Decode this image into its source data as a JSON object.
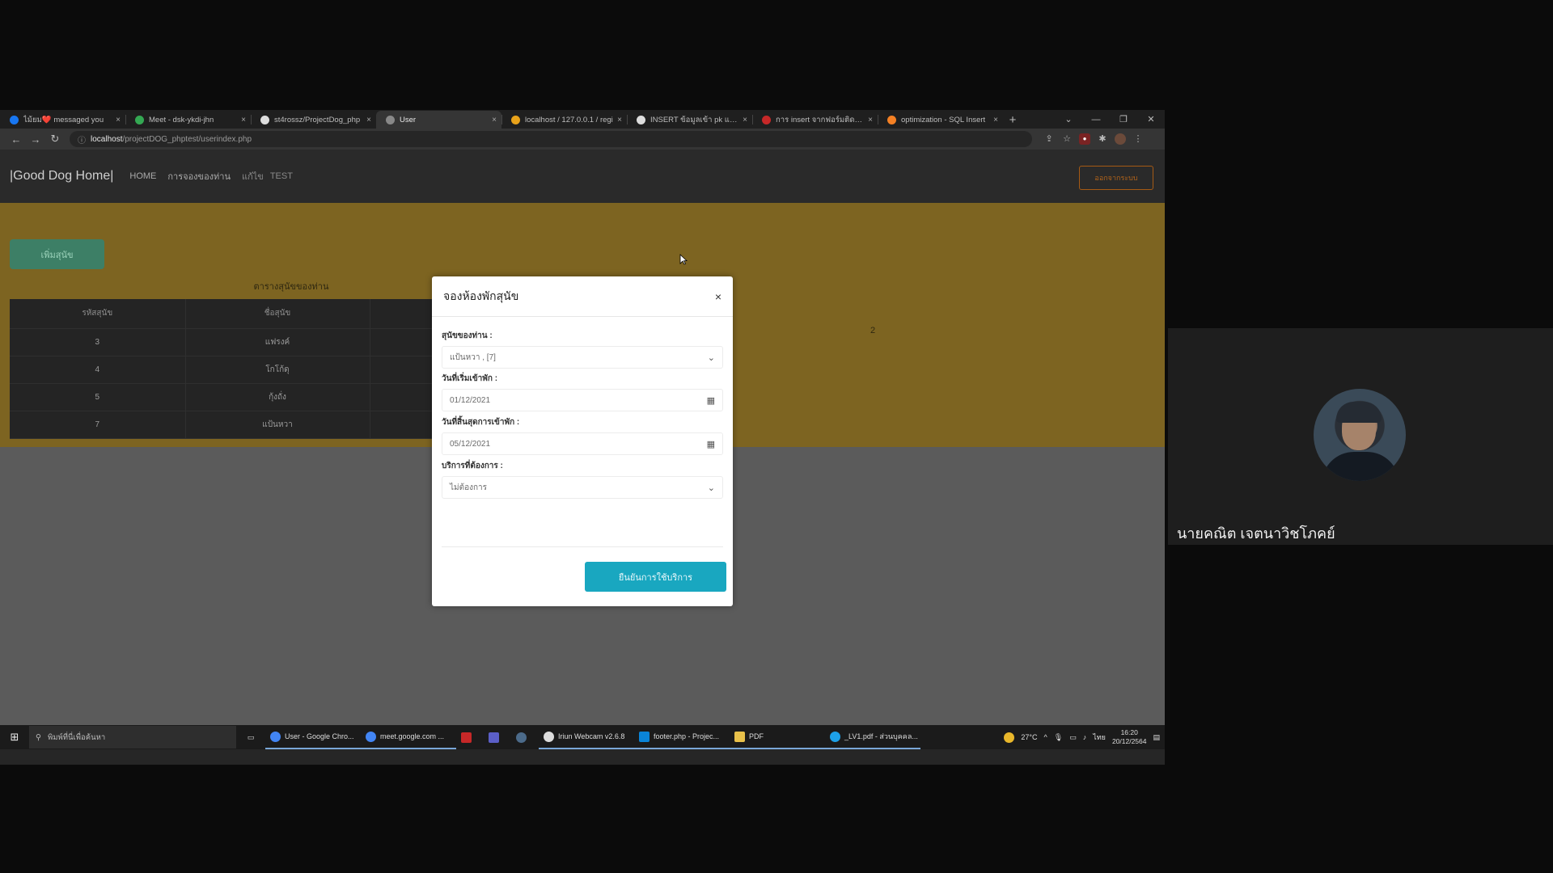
{
  "browser": {
    "tabs": [
      {
        "label": "ไม้ยม❤️ messaged you",
        "color": "#1877f2",
        "active": false
      },
      {
        "label": "Meet - dsk-ykdi-jhn",
        "color": "#34a853",
        "active": false
      },
      {
        "label": "st4rossz/ProjectDog_php",
        "color": "#dddddd",
        "active": false
      },
      {
        "label": "User",
        "color": "#888888",
        "active": true
      },
      {
        "label": "localhost / 127.0.0.1 / regi",
        "color": "#e8a21a",
        "active": false
      },
      {
        "label": "INSERT ข้อมูลเข้า pk และ fk",
        "color": "#dddddd",
        "active": false
      },
      {
        "label": "การ insert จากฟอร์มติดตาม",
        "color": "#c62828",
        "active": false
      },
      {
        "label": "optimization - SQL Insert",
        "color": "#f48024",
        "active": false
      }
    ],
    "new_tab_glyph": "+",
    "tab_close_glyph": "×",
    "window_controls": [
      "⌄",
      "—",
      "❐",
      "✕"
    ],
    "url_host": "localhost",
    "url_path": "/projectDOG_phptest/userindex.php"
  },
  "site": {
    "brand": "|Good Dog Home|",
    "nav": [
      "HOME",
      "การจองของท่าน",
      "แก้ไข",
      "TEST"
    ],
    "logout": "ออกจากระบบ",
    "add_dog": "เพิ่มสุนัข",
    "table_title": "ตารางสุนัขของท่าน",
    "table_headers": [
      "รหัสสุนัข",
      "ชื่อสุนัข"
    ],
    "table_rows": [
      [
        "3",
        "แฟรงค์"
      ],
      [
        "4",
        "โกโก้ดุ"
      ],
      [
        "5",
        "กุ้งถั่ง"
      ],
      [
        "7",
        "แป้นหวา"
      ]
    ],
    "page_number": "2"
  },
  "modal": {
    "title": "จองห้องพักสุนัข",
    "close_glyph": "×",
    "dog_label": "สุนัขของท่าน :",
    "dog_value": "แป้นหวา , [7]",
    "start_label": "วันที่เริ่มเข้าพัก :",
    "start_value": "01/12/2021",
    "end_label": "วันที่สิ้นสุดการเข้าพัก :",
    "end_value": "05/12/2021",
    "service_label": "บริการที่ต้องการ :",
    "service_value": "ไม่ต้องการ",
    "submit": "ยืนยันการใช้บริการ"
  },
  "taskbar": {
    "search_placeholder": "พิมพ์ที่นี่เพื่อค้นหา",
    "items": [
      {
        "label": "User - Google Chro...",
        "color": "#4285f4"
      },
      {
        "label": "meet.google.com ...",
        "color": "#4285f4"
      },
      {
        "label": "",
        "color": "#c62828"
      },
      {
        "label": "",
        "color": "#5b5fc7"
      },
      {
        "label": "",
        "color": "#1b2838"
      },
      {
        "label": "Iriun Webcam v2.6.8",
        "color": "#dddddd"
      },
      {
        "label": "footer.php - Projec...",
        "color": "#0a84d8"
      },
      {
        "label": "PDF",
        "color": "#e8c04a"
      },
      {
        "label": "_LV1.pdf - ส่วนบุคคล...",
        "color": "#1da0e8"
      }
    ],
    "weather": "27°C",
    "lang": "ไทย",
    "time": "16:20",
    "date": "20/12/2564"
  },
  "meeting": {
    "participant_name": "นายคณิต เจตนาวิชโภคย์"
  }
}
